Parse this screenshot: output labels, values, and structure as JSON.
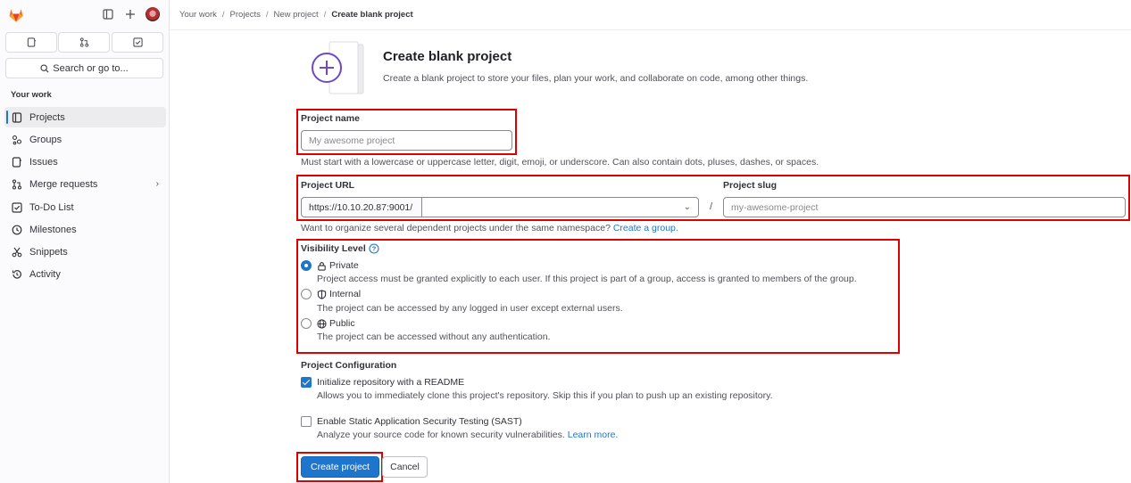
{
  "sidebar": {
    "search_label": "Search or go to...",
    "section_title": "Your work",
    "items": [
      {
        "label": "Projects",
        "icon": "project-icon",
        "active": true
      },
      {
        "label": "Groups",
        "icon": "group-icon"
      },
      {
        "label": "Issues",
        "icon": "issues-icon"
      },
      {
        "label": "Merge requests",
        "icon": "merge-request-icon",
        "has_submenu": true
      },
      {
        "label": "To-Do List",
        "icon": "todo-icon"
      },
      {
        "label": "Milestones",
        "icon": "milestone-icon"
      },
      {
        "label": "Snippets",
        "icon": "snippet-icon"
      },
      {
        "label": "Activity",
        "icon": "history-icon"
      }
    ]
  },
  "breadcrumb": {
    "items": [
      "Your work",
      "Projects",
      "New project"
    ],
    "current": "Create blank project"
  },
  "page": {
    "title": "Create blank project",
    "description": "Create a blank project to store your files, plan your work, and collaborate on code, among other things."
  },
  "form": {
    "project_name_label": "Project name",
    "project_name_placeholder": "My awesome project",
    "project_name_help": "Must start with a lowercase or uppercase letter, digit, emoji, or underscore. Can also contain dots, pluses, dashes, or spaces.",
    "project_url_label": "Project URL",
    "project_url_prefix": "https://10.10.20.87:9001/",
    "slash": "/",
    "project_slug_label": "Project slug",
    "project_slug_placeholder": "my-awesome-project",
    "namespace_help": "Want to organize several dependent projects under the same namespace?",
    "namespace_help_link": "Create a group.",
    "visibility_label": "Visibility Level",
    "visibility_options": [
      {
        "label": "Private",
        "icon": "lock-icon",
        "description": "Project access must be granted explicitly to each user. If this project is part of a group, access is granted to members of the group.",
        "selected": true
      },
      {
        "label": "Internal",
        "icon": "shield-icon",
        "description": "The project can be accessed by any logged in user except external users.",
        "selected": false
      },
      {
        "label": "Public",
        "icon": "earth-icon",
        "description": "The project can be accessed without any authentication.",
        "selected": false
      }
    ],
    "config_label": "Project Configuration",
    "readme_label": "Initialize repository with a README",
    "readme_help": "Allows you to immediately clone this project's repository. Skip this if you plan to push up an existing repository.",
    "readme_checked": true,
    "sast_label": "Enable Static Application Security Testing (SAST)",
    "sast_help": "Analyze your source code for known security vulnerabilities.",
    "sast_help_link": "Learn more.",
    "sast_checked": false,
    "create_button": "Create project",
    "cancel_button": "Cancel"
  },
  "colors": {
    "accent": "#1f75cb",
    "highlight_box": "#e00000",
    "brand": "#e24329"
  }
}
